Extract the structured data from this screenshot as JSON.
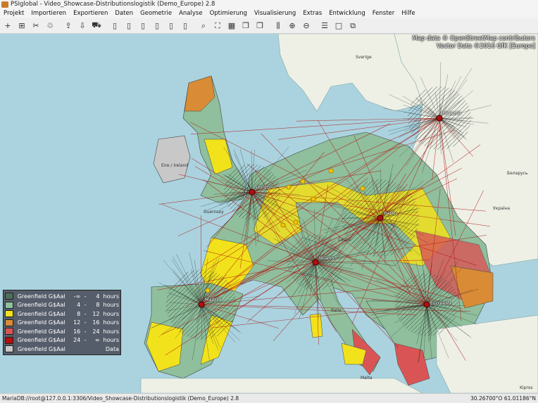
{
  "window": {
    "title": "PSIglobal - Video_Showcase-Distributionslogistik (Demo_Europe) 2.8"
  },
  "menu": [
    "Projekt",
    "Importieren",
    "Exportieren",
    "Daten",
    "Geometrie",
    "Analyse",
    "Optimierung",
    "Visualisierung",
    "Extras",
    "Entwicklung",
    "Fenster",
    "Hilfe"
  ],
  "toolbar": {
    "icons": [
      "new-file-icon",
      "add-icon",
      "cut-icon",
      "clean-icon",
      "import-icon",
      "export-icon",
      "car-icon",
      "page-icon",
      "page-icon",
      "page-icon",
      "page-icon",
      "page-icon",
      "page-icon",
      "search-icon",
      "zoom-extent-icon",
      "map-icon",
      "layers-icon",
      "layers-icon",
      "bar-chart-icon",
      "zoom-in-icon",
      "zoom-out-icon",
      "filter-icon",
      "square-icon",
      "windows-icon"
    ]
  },
  "map": {
    "attribution_line1": "Map data © OpenStreetMap contributors",
    "attribution_line2": "Vector Data ©2016 GfK [Europe]",
    "hubs": [
      {
        "name": "London"
      },
      {
        "name": "Berlin"
      },
      {
        "name": "Helsinki"
      },
      {
        "name": "Milano"
      },
      {
        "name": "Madrid"
      },
      {
        "name": "Bucuresti"
      }
    ],
    "places": [
      "Sverige",
      "Eire / Ireland",
      "Guernsey",
      "Česko",
      "Italia",
      "Malta",
      "Беларусь",
      "Україна",
      "Kipros"
    ]
  },
  "legend": {
    "colors": [
      "#4d6e5c",
      "#8fbf9c",
      "#f2e21c",
      "#d98b35",
      "#d95555",
      "#b01010",
      "#c8c8c8"
    ],
    "rows": [
      {
        "name": "Greenfield G$Aal",
        "from": "-∞",
        "dash": "-",
        "to": "4",
        "unit": "hours"
      },
      {
        "name": "Greenfield G$Aal",
        "from": "4",
        "dash": "-",
        "to": "8",
        "unit": "hours"
      },
      {
        "name": "Greenfield G$Aal",
        "from": "8",
        "dash": "-",
        "to": "12",
        "unit": "hours"
      },
      {
        "name": "Greenfield G$Aal",
        "from": "12",
        "dash": "-",
        "to": "16",
        "unit": "hours"
      },
      {
        "name": "Greenfield G$Aal",
        "from": "16",
        "dash": "-",
        "to": "24",
        "unit": "hours"
      },
      {
        "name": "Greenfield G$Aal",
        "from": "24",
        "dash": "-",
        "to": "∞",
        "unit": "hours"
      },
      {
        "name": "Greenfield G$Aal",
        "from": "",
        "dash": "",
        "to": "",
        "unit": "Data"
      }
    ]
  },
  "status": {
    "connection": "MariaDB://root@127.0.0.1:3306/Video_Showcase-Distributionslogistik (Demo_Europe) 2.8",
    "coords": "30.26700°O 61.01186°N"
  }
}
